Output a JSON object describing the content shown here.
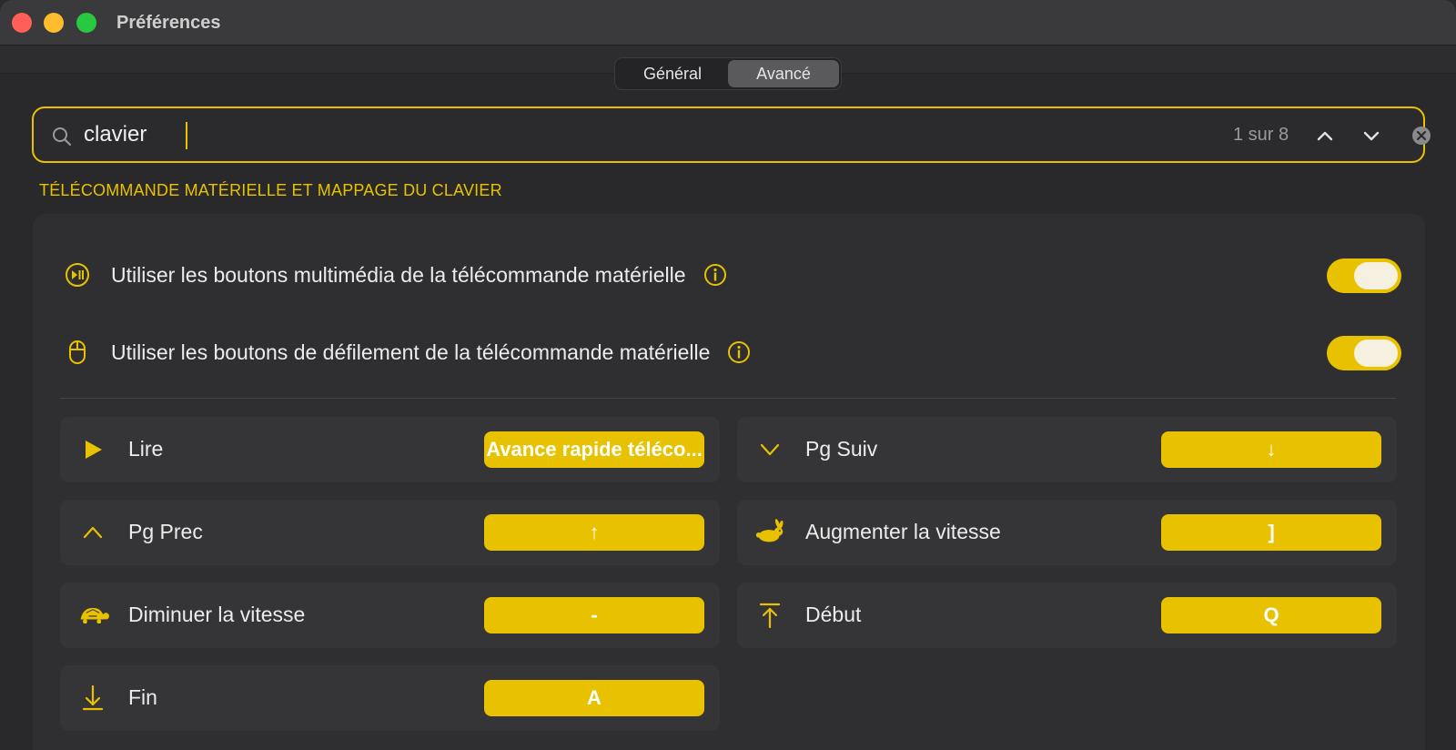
{
  "window": {
    "title": "Préférences"
  },
  "tabs": [
    {
      "label": "Général",
      "active": false
    },
    {
      "label": "Avancé",
      "active": true
    }
  ],
  "search": {
    "value": "clavier",
    "result_count": "1 sur 8"
  },
  "section": {
    "header": "TÉLÉCOMMANDE MATÉRIELLE ET MAPPAGE DU CLAVIER"
  },
  "toggles": [
    {
      "label": "Utiliser les boutons multimédia de la télécommande matérielle",
      "icon": "play-pause-circle-icon",
      "enabled": true
    },
    {
      "label": "Utiliser les boutons de défilement de la télécommande matérielle",
      "icon": "mouse-icon",
      "enabled": true
    }
  ],
  "mappings": [
    {
      "label": "Lire",
      "icon": "play-icon",
      "key": "Avance rapide téléco..."
    },
    {
      "label": "Pg Suiv",
      "icon": "chevron-down-icon",
      "key": "↓"
    },
    {
      "label": "Pg Prec",
      "icon": "chevron-up-icon",
      "key": "↑"
    },
    {
      "label": "Augmenter la vitesse",
      "icon": "hare-icon",
      "key": "]"
    },
    {
      "label": "Diminuer la vitesse",
      "icon": "tortoise-icon",
      "key": "-"
    },
    {
      "label": "Début",
      "icon": "arrow-to-top-icon",
      "key": "Q"
    },
    {
      "label": "Fin",
      "icon": "arrow-to-bottom-icon",
      "key": "A"
    }
  ],
  "colors": {
    "accent": "#e8c200",
    "background": "#2b2b2d",
    "card": "#353537"
  }
}
